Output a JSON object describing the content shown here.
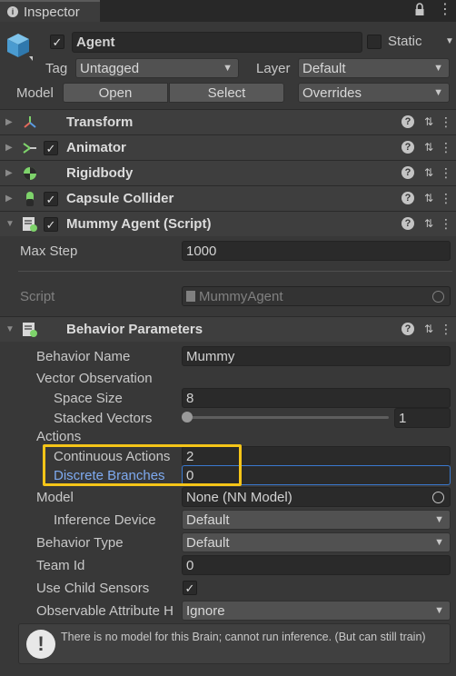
{
  "window": {
    "tab_title": "Inspector"
  },
  "header": {
    "object_name": "Agent",
    "static_label": "Static",
    "tag_label": "Tag",
    "tag_value": "Untagged",
    "layer_label": "Layer",
    "layer_value": "Default",
    "model_label": "Model",
    "open_label": "Open",
    "select_label": "Select",
    "overrides_label": "Overrides"
  },
  "components": {
    "transform": "Transform",
    "animator": "Animator",
    "rigidbody": "Rigidbody",
    "capsule_collider": "Capsule Collider",
    "mummy_agent": "Mummy Agent (Script)",
    "behavior_parameters": "Behavior Parameters"
  },
  "mummy_agent": {
    "max_step_label": "Max Step",
    "max_step_value": "1000",
    "script_label": "Script",
    "script_value": "MummyAgent"
  },
  "behavior": {
    "behavior_name_label": "Behavior Name",
    "behavior_name_value": "Mummy",
    "vector_observation_label": "Vector Observation",
    "space_size_label": "Space Size",
    "space_size_value": "8",
    "stacked_vectors_label": "Stacked Vectors",
    "stacked_vectors_value": "1",
    "stacked_vectors_fraction": 0,
    "actions_label": "Actions",
    "continuous_actions_label": "Continuous Actions",
    "continuous_actions_value": "2",
    "discrete_branches_label": "Discrete Branches",
    "discrete_branches_value": "0",
    "model_label": "Model",
    "model_value": "None (NN Model)",
    "inference_device_label": "Inference Device",
    "inference_device_value": "Default",
    "behavior_type_label": "Behavior Type",
    "behavior_type_value": "Default",
    "team_id_label": "Team Id",
    "team_id_value": "0",
    "use_child_sensors_label": "Use Child Sensors",
    "observable_attribute_label": "Observable Attribute H",
    "observable_attribute_value": "Ignore",
    "warning_text": "There is no model for this Brain; cannot run inference. (But can still train)"
  },
  "colors": {
    "highlight": "#f5c518",
    "focus": "#3a79d0",
    "label_active": "#7eaaf0"
  }
}
